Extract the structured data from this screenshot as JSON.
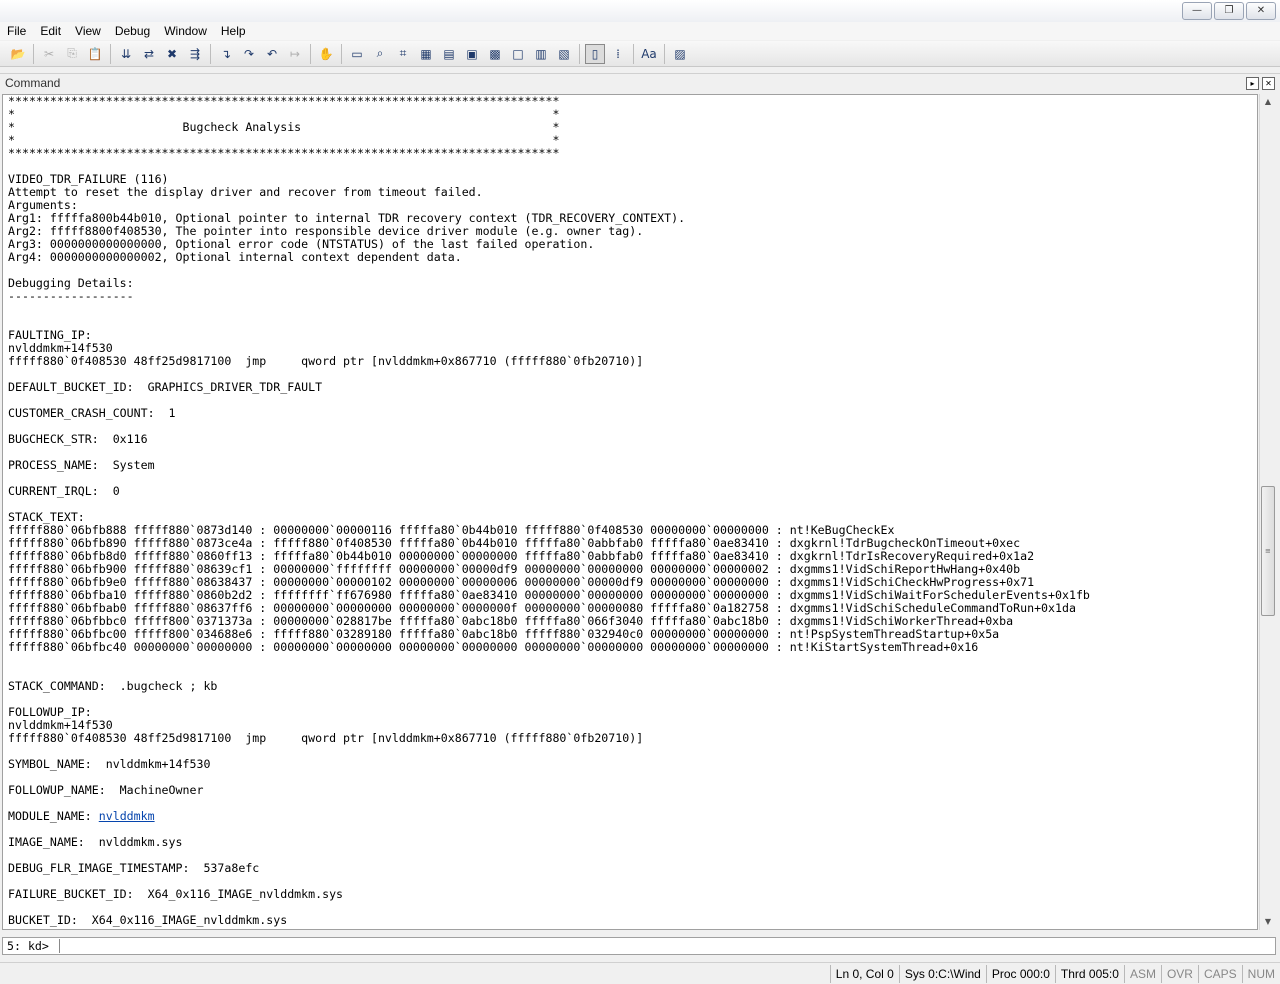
{
  "window": {
    "controls": [
      "minimize",
      "restore",
      "close"
    ]
  },
  "menu": [
    "File",
    "Edit",
    "View",
    "Debug",
    "Window",
    "Help"
  ],
  "toolbar": {
    "buttons": [
      {
        "name": "open-icon",
        "glyph": "📂",
        "disabled": false
      },
      {
        "sep": true
      },
      {
        "name": "cut-icon",
        "glyph": "✂",
        "disabled": true
      },
      {
        "name": "copy-icon",
        "glyph": "⎘",
        "disabled": true
      },
      {
        "name": "paste-icon",
        "glyph": "📋",
        "disabled": true
      },
      {
        "sep": true
      },
      {
        "name": "go-icon",
        "glyph": "⇊",
        "disabled": false
      },
      {
        "name": "restart-icon",
        "glyph": "⇄",
        "disabled": false
      },
      {
        "name": "stop-debugging-icon",
        "glyph": "✖",
        "disabled": false
      },
      {
        "name": "break-icon",
        "glyph": "⇶",
        "disabled": false
      },
      {
        "sep": true
      },
      {
        "name": "step-into-icon",
        "glyph": "↴",
        "disabled": false
      },
      {
        "name": "step-over-icon",
        "glyph": "↷",
        "disabled": false
      },
      {
        "name": "step-out-icon",
        "glyph": "↶",
        "disabled": false
      },
      {
        "name": "run-to-cursor-icon",
        "glyph": "↦",
        "disabled": true
      },
      {
        "sep": true
      },
      {
        "name": "insert-breakpoint-icon",
        "glyph": "✋",
        "disabled": false
      },
      {
        "sep": true
      },
      {
        "name": "command-window-icon",
        "glyph": "▭",
        "disabled": false
      },
      {
        "name": "watch-window-icon",
        "glyph": "⌕",
        "disabled": false
      },
      {
        "name": "locals-window-icon",
        "glyph": "⌗",
        "disabled": false
      },
      {
        "name": "registers-window-icon",
        "glyph": "▦",
        "disabled": false
      },
      {
        "name": "memory-window-icon",
        "glyph": "▤",
        "disabled": false
      },
      {
        "name": "call-stack-window-icon",
        "glyph": "▣",
        "disabled": false
      },
      {
        "name": "disassembly-window-icon",
        "glyph": "▩",
        "disabled": false
      },
      {
        "name": "scratch-pad-window-icon",
        "glyph": "□",
        "disabled": false
      },
      {
        "name": "processes-threads-window-icon",
        "glyph": "▥",
        "disabled": false
      },
      {
        "name": "command-browser-window-icon",
        "glyph": "▧",
        "disabled": false
      },
      {
        "sep": true
      },
      {
        "name": "source-mode-icon",
        "glyph": "▯",
        "disabled": false,
        "pressed": true
      },
      {
        "name": "binary-mode-icon",
        "glyph": "⁞",
        "disabled": false
      },
      {
        "sep": true
      },
      {
        "name": "font-icon",
        "glyph": "Aa",
        "disabled": false
      },
      {
        "sep": true
      },
      {
        "name": "options-icon",
        "glyph": "▨",
        "disabled": false
      }
    ]
  },
  "panel": {
    "title": "Command"
  },
  "output_lines": [
    "*******************************************************************************",
    "*                                                                             *",
    "*                        Bugcheck Analysis                                    *",
    "*                                                                             *",
    "*******************************************************************************",
    "",
    "VIDEO_TDR_FAILURE (116)",
    "Attempt to reset the display driver and recover from timeout failed.",
    "Arguments:",
    "Arg1: fffffa800b44b010, Optional pointer to internal TDR recovery context (TDR_RECOVERY_CONTEXT).",
    "Arg2: fffff8800f408530, The pointer into responsible device driver module (e.g. owner tag).",
    "Arg3: 0000000000000000, Optional error code (NTSTATUS) of the last failed operation.",
    "Arg4: 0000000000000002, Optional internal context dependent data.",
    "",
    "Debugging Details:",
    "------------------",
    "",
    "",
    "FAULTING_IP:",
    "nvlddmkm+14f530",
    "fffff880`0f408530 48ff25d9817100  jmp     qword ptr [nvlddmkm+0x867710 (fffff880`0fb20710)]",
    "",
    "DEFAULT_BUCKET_ID:  GRAPHICS_DRIVER_TDR_FAULT",
    "",
    "CUSTOMER_CRASH_COUNT:  1",
    "",
    "BUGCHECK_STR:  0x116",
    "",
    "PROCESS_NAME:  System",
    "",
    "CURRENT_IRQL:  0",
    "",
    "STACK_TEXT:",
    "fffff880`06bfb888 fffff880`0873d140 : 00000000`00000116 fffffa80`0b44b010 fffff880`0f408530 00000000`00000000 : nt!KeBugCheckEx",
    "fffff880`06bfb890 fffff880`0873ce4a : fffff880`0f408530 fffffa80`0b44b010 fffffa80`0abbfab0 fffffa80`0ae83410 : dxgkrnl!TdrBugcheckOnTimeout+0xec",
    "fffff880`06bfb8d0 fffff880`0860ff13 : fffffa80`0b44b010 00000000`00000000 fffffa80`0abbfab0 fffffa80`0ae83410 : dxgkrnl!TdrIsRecoveryRequired+0x1a2",
    "fffff880`06bfb900 fffff880`08639cf1 : 00000000`ffffffff 00000000`00000df9 00000000`00000000 00000000`00000002 : dxgmms1!VidSchiReportHwHang+0x40b",
    "fffff880`06bfb9e0 fffff880`08638437 : 00000000`00000102 00000000`00000006 00000000`00000df9 00000000`00000000 : dxgmms1!VidSchiCheckHwProgress+0x71",
    "fffff880`06bfba10 fffff880`0860b2d2 : ffffffff`ff676980 fffffa80`0ae83410 00000000`00000000 00000000`00000000 : dxgmms1!VidSchiWaitForSchedulerEvents+0x1fb",
    "fffff880`06bfbab0 fffff880`08637ff6 : 00000000`00000000 00000000`0000000f 00000000`00000080 fffffa80`0a182758 : dxgmms1!VidSchiScheduleCommandToRun+0x1da",
    "fffff880`06bfbbc0 fffff800`0371373a : 00000000`028817be fffffa80`0abc18b0 fffffa80`066f3040 fffffa80`0abc18b0 : dxgmms1!VidSchiWorkerThread+0xba",
    "fffff880`06bfbc00 fffff800`034688e6 : fffff880`03289180 fffffa80`0abc18b0 fffff880`032940c0 00000000`00000000 : nt!PspSystemThreadStartup+0x5a",
    "fffff880`06bfbc40 00000000`00000000 : 00000000`00000000 00000000`00000000 00000000`00000000 00000000`00000000 : nt!KiStartSystemThread+0x16",
    "",
    "",
    "STACK_COMMAND:  .bugcheck ; kb",
    "",
    "FOLLOWUP_IP:",
    "nvlddmkm+14f530",
    "fffff880`0f408530 48ff25d9817100  jmp     qword ptr [nvlddmkm+0x867710 (fffff880`0fb20710)]",
    "",
    "SYMBOL_NAME:  nvlddmkm+14f530",
    "",
    "FOLLOWUP_NAME:  MachineOwner",
    "",
    {
      "prefix": "MODULE_NAME: ",
      "link": "nvlddmkm"
    },
    "",
    "IMAGE_NAME:  nvlddmkm.sys",
    "",
    "DEBUG_FLR_IMAGE_TIMESTAMP:  537a8efc",
    "",
    "FAILURE_BUCKET_ID:  X64_0x116_IMAGE_nvlddmkm.sys",
    "",
    "BUCKET_ID:  X64_0x116_IMAGE_nvlddmkm.sys"
  ],
  "command": {
    "prompt": "5: kd>",
    "value": ""
  },
  "status": {
    "position": "Ln 0, Col 0",
    "sys": "Sys 0:C:\\Wind",
    "proc": "Proc 000:0",
    "thrd": "Thrd 005:0",
    "asm": "ASM",
    "ovr": "OVR",
    "caps": "CAPS",
    "num": "NUM"
  }
}
